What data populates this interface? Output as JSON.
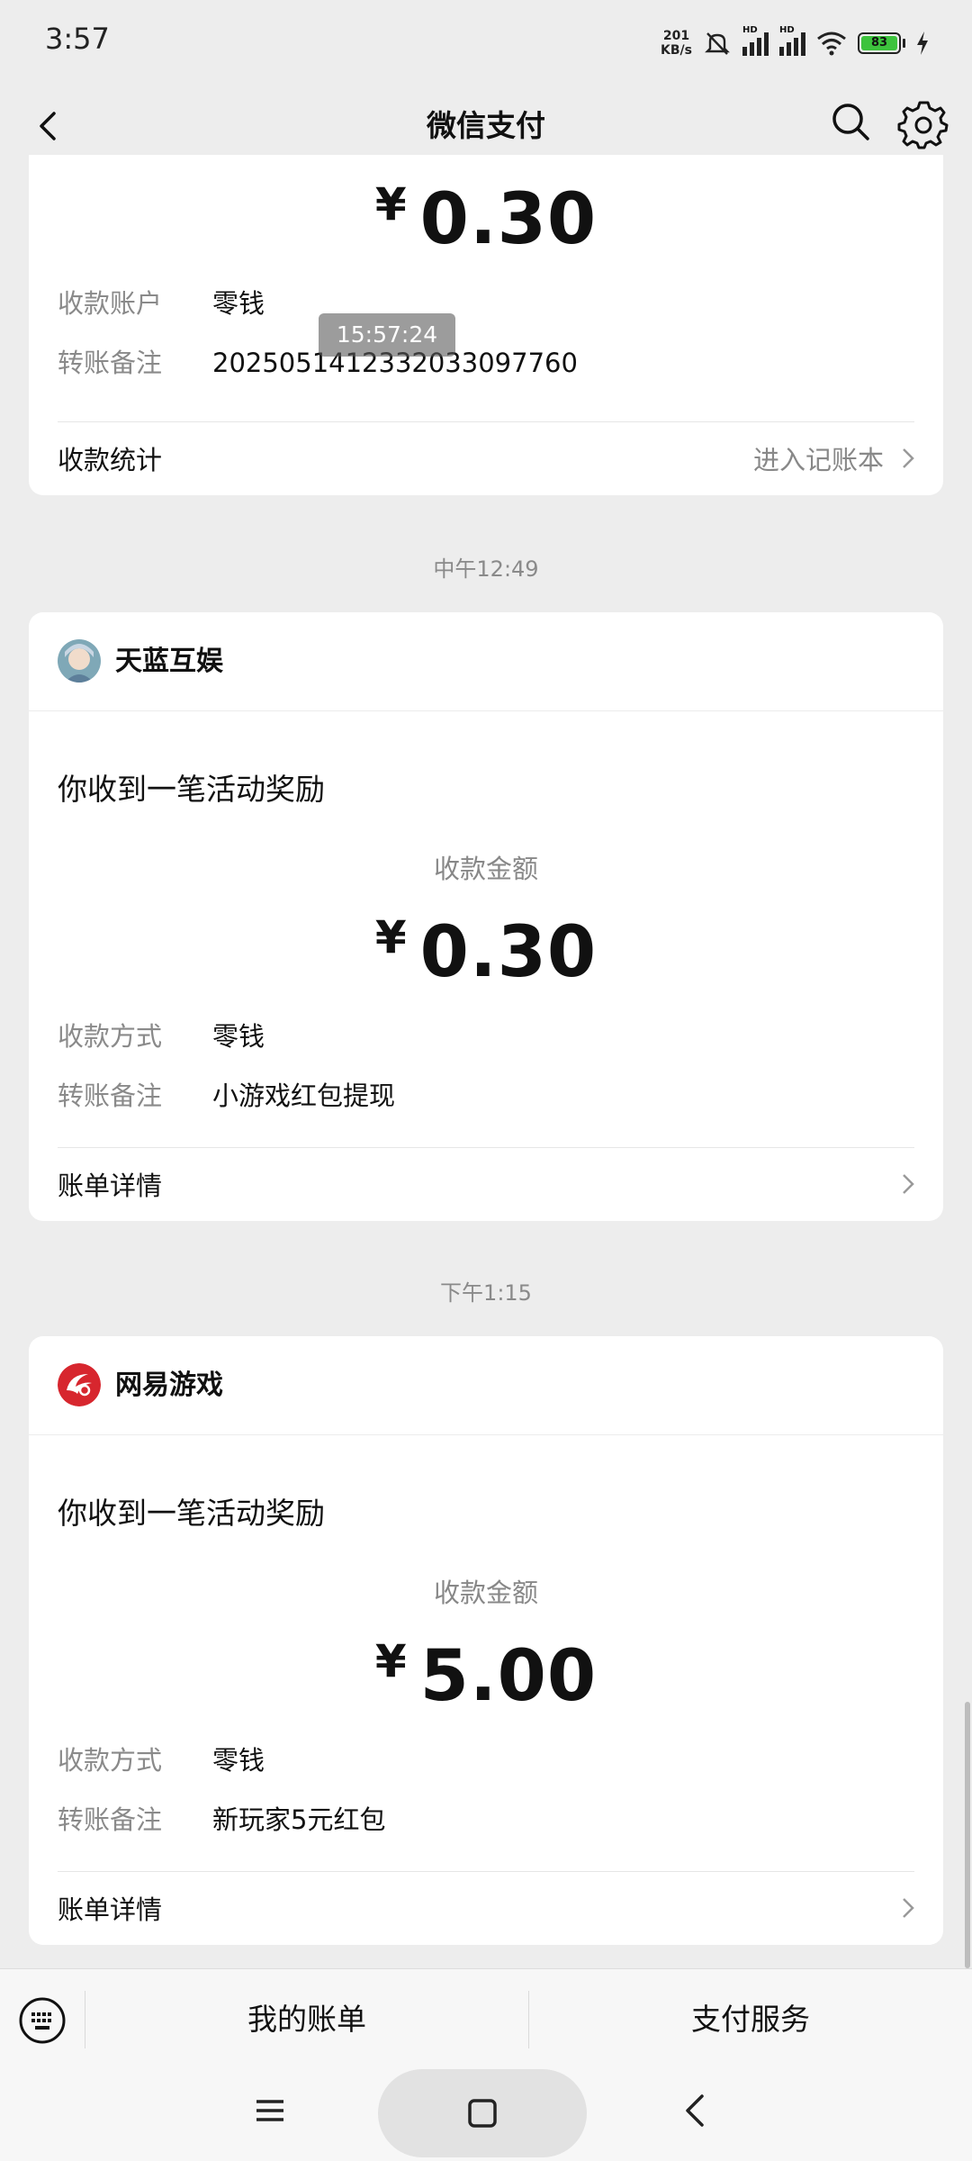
{
  "status_bar": {
    "time": "3:57",
    "net_speed_value": "201",
    "net_speed_unit": "KB/s",
    "signal_tag": "HD",
    "battery_level": "83"
  },
  "nav": {
    "title": "微信支付"
  },
  "cards": [
    {
      "amount_symbol": "¥",
      "amount": "0.30",
      "rows": [
        {
          "key": "收款账户",
          "value": "零钱"
        },
        {
          "key": "转账备注",
          "value": "2025051412332033097760"
        }
      ],
      "footer_label": "收款统计",
      "footer_right": "进入记账本",
      "overlay_time": "15:57:24"
    },
    {
      "timestamp": "中午12:49",
      "merchant": "天蓝互娱",
      "message": "你收到一笔活动奖励",
      "amount_label": "收款金额",
      "amount_symbol": "¥",
      "amount": "0.30",
      "rows": [
        {
          "key": "收款方式",
          "value": "零钱"
        },
        {
          "key": "转账备注",
          "value": "小游戏红包提现"
        }
      ],
      "footer_label": "账单详情"
    },
    {
      "timestamp": "下午1:15",
      "merchant": "网易游戏",
      "message": "你收到一笔活动奖励",
      "amount_label": "收款金额",
      "amount_symbol": "¥",
      "amount": "5.00",
      "rows": [
        {
          "key": "收款方式",
          "value": "零钱"
        },
        {
          "key": "转账备注",
          "value": "新玩家5元红包"
        }
      ],
      "footer_label": "账单详情"
    }
  ],
  "bottom_bar": {
    "tab1": "我的账单",
    "tab2": "支付服务"
  },
  "colors": {
    "background": "#ededed",
    "card": "#ffffff",
    "netease_red": "#d7262e",
    "battery_green": "#3dc33d"
  },
  "icons": [
    "back-arrow-icon",
    "search-icon",
    "gear-icon",
    "chevron-right-icon",
    "keyboard-icon",
    "menu-icon",
    "home-icon",
    "nav-back-icon",
    "wifi-icon",
    "mute-icon",
    "charging-icon"
  ]
}
